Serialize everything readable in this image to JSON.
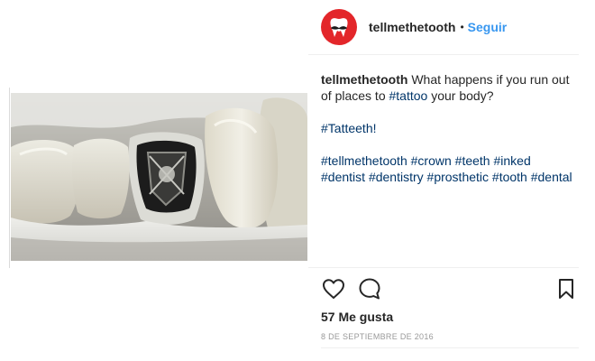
{
  "post": {
    "username": "tellmethetooth",
    "follow_label": "Seguir",
    "separator": "•",
    "image_alt": "Close-up of a dental crown engraved with a skull-and-swords shield logo between natural teeth",
    "caption": {
      "username": "tellmethetooth",
      "text": "What happens if you run out of places to ",
      "tag_inline": "#tattoo",
      "text_after": " your body?",
      "line2": "#Tatteeth!",
      "hashtags": [
        "#tellmethetooth",
        "#crown",
        "#teeth",
        "#inked",
        "#dentist",
        "#dentistry",
        "#prosthetic",
        "#tooth",
        "#dental"
      ]
    },
    "likes": "57 Me gusta",
    "date": "8 DE SEPTIEMBRE DE 2016"
  },
  "icons": {
    "like": "heart-outline-icon",
    "comment": "speech-bubble-icon",
    "save": "bookmark-icon",
    "avatar": "tooth-mustache-logo"
  },
  "colors": {
    "brand_red": "#e3262a",
    "link_blue": "#3897f0",
    "hashtag": "#003569",
    "text": "#262626",
    "muted": "#999999"
  }
}
